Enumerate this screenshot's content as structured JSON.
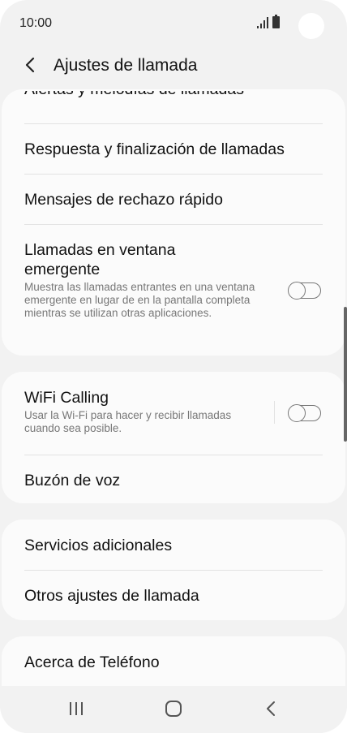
{
  "status_bar": {
    "time": "10:00"
  },
  "header": {
    "title": "Ajustes de llamada"
  },
  "card1": {
    "partial_item": "Alertas y melodías de llamadas",
    "items": [
      {
        "label": "Respuesta y finalización de llamadas"
      },
      {
        "label": "Mensajes de rechazo rápido"
      },
      {
        "label": "Llamadas en ventana emergente",
        "description": "Muestra las llamadas entrantes en una ventana emergente en lugar de en la pantalla completa mientras se utilizan otras aplicaciones.",
        "toggle_on": false
      }
    ]
  },
  "card2": {
    "items": [
      {
        "label": "WiFi Calling",
        "description": "Usar la Wi-Fi para hacer y recibir llamadas cuando sea posible.",
        "toggle_on": false
      },
      {
        "label": "Buzón de voz"
      }
    ]
  },
  "card3": {
    "items": [
      {
        "label": "Servicios adicionales"
      },
      {
        "label": "Otros ajustes de llamada"
      }
    ]
  },
  "card4": {
    "items": [
      {
        "label": "Acerca de Teléfono"
      }
    ]
  }
}
